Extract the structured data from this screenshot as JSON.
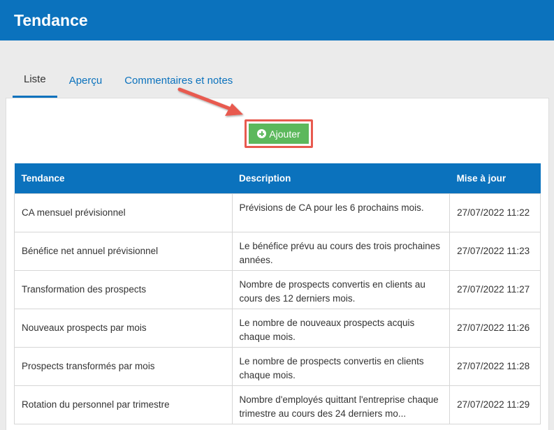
{
  "header": {
    "title": "Tendance"
  },
  "tabs": [
    {
      "label": "Liste",
      "active": true
    },
    {
      "label": "Aperçu",
      "active": false
    },
    {
      "label": "Commentaires et notes",
      "active": false
    }
  ],
  "toolbar": {
    "add_label": "Ajouter",
    "add_icon": "plus-circle-icon"
  },
  "table": {
    "headers": [
      "Tendance",
      "Description",
      "Mise à jour"
    ],
    "rows": [
      {
        "name": "CA mensuel prévisionnel",
        "description": "Prévisions de CA pour les 6 prochains mois.",
        "updated": "27/07/2022 11:22"
      },
      {
        "name": "Bénéfice net annuel prévisionnel",
        "description": "Le bénéfice prévu au cours des trois prochaines années.",
        "updated": "27/07/2022 11:23"
      },
      {
        "name": "Transformation des prospects",
        "description": "Nombre de prospects convertis en clients au cours des 12 derniers mois.",
        "updated": "27/07/2022 11:27"
      },
      {
        "name": "Nouveaux prospects par mois",
        "description": "Le nombre de nouveaux prospects acquis chaque mois.",
        "updated": "27/07/2022 11:26"
      },
      {
        "name": "Prospects transformés par mois",
        "description": "Le nombre de prospects convertis en clients chaque mois.",
        "updated": "27/07/2022 11:28"
      },
      {
        "name": "Rotation du personnel par trimestre",
        "description": "Nombre d'employés quittant l'entreprise chaque trimestre au cours des 24 derniers mo...",
        "updated": "27/07/2022 11:29"
      }
    ]
  },
  "colors": {
    "brand": "#0b72bd",
    "add_button": "#5cb85c",
    "highlight": "#e85a4f"
  }
}
